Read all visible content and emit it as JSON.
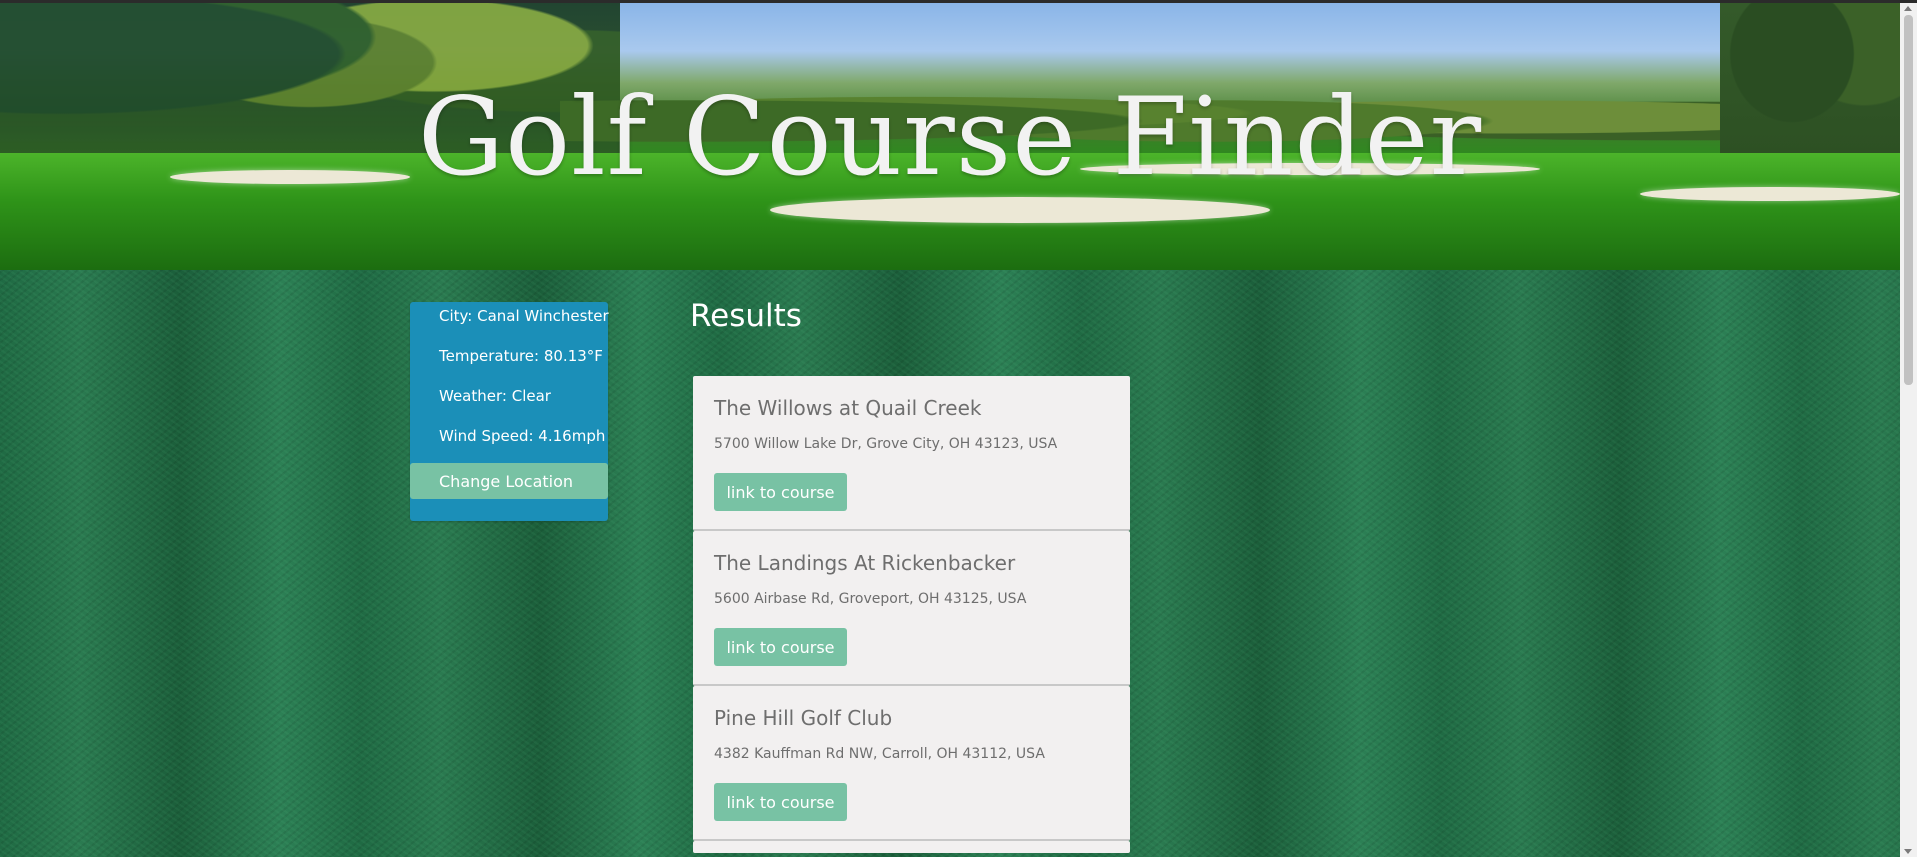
{
  "header": {
    "title": "Golf Course Finder"
  },
  "weather": {
    "city": "City: Canal Winchester",
    "temperature": "Temperature: 80.13°F",
    "conditions": "Weather: Clear",
    "wind_speed": "Wind Speed: 4.16mph",
    "change_location_label": "Change Location"
  },
  "results": {
    "title": "Results",
    "courses": [
      {
        "name": "The Willows at Quail Creek",
        "address": "5700 Willow Lake Dr, Grove City, OH 43123, USA",
        "link_label": "link to course"
      },
      {
        "name": "The Landings At Rickenbacker",
        "address": "5600 Airbase Rd, Groveport, OH 43125, USA",
        "link_label": "link to course"
      },
      {
        "name": "Pine Hill Golf Club",
        "address": "4382 Kauffman Rd NW, Carroll, OH 43112, USA",
        "link_label": "link to course"
      }
    ]
  },
  "colors": {
    "accent_button": "#78c2a4",
    "weather_panel": "#1b8fb8",
    "card_background": "#f2f0f0"
  }
}
